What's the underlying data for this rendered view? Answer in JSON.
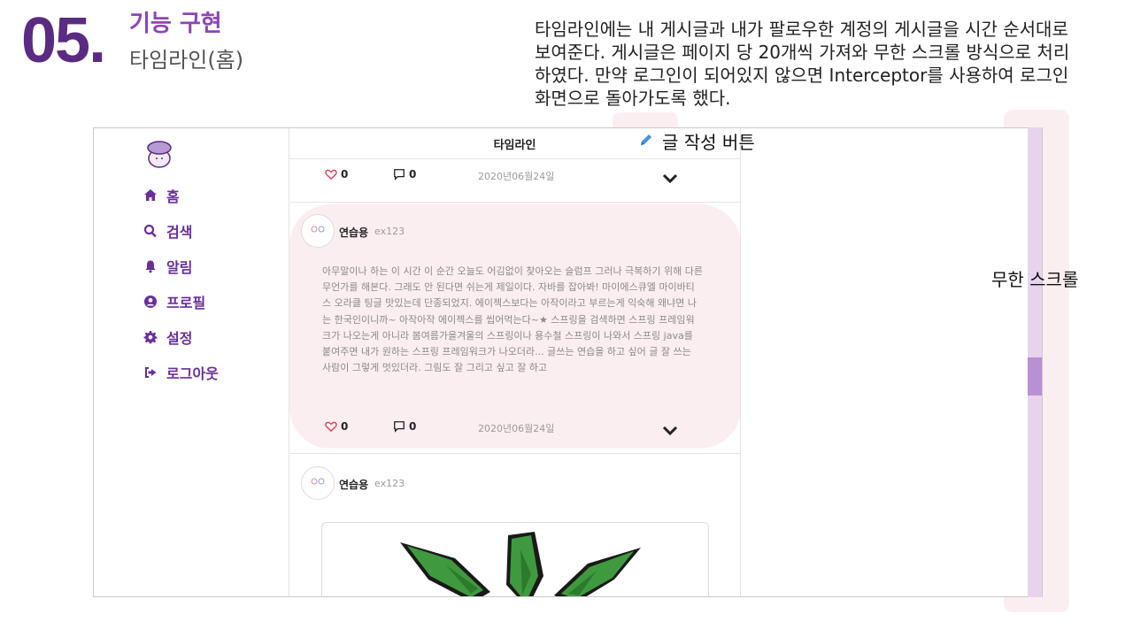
{
  "slide": {
    "number": "05",
    "dot": ".",
    "title": "기능 구현",
    "subtitle": "타임라인(홈)",
    "description": "타임라인에는 내 게시글과 내가 팔로우한 계정의 게시글을 시간 순서대로 보여준다. 게시글은 페이지 당 20개씩 가져와 무한 스크롤 방식으로 처리하였다. 만약 로그인이 되어있지 않으면 Interceptor를 사용하여 로그인 화면으로 돌아가도록 했다."
  },
  "sidebar": {
    "items": [
      {
        "label": "홈",
        "icon": "home-icon"
      },
      {
        "label": "검색",
        "icon": "search-icon"
      },
      {
        "label": "알림",
        "icon": "bell-icon"
      },
      {
        "label": "프로필",
        "icon": "user-circle-icon"
      },
      {
        "label": "설정",
        "icon": "gear-icon"
      },
      {
        "label": "로그아웃",
        "icon": "sign-out-icon"
      }
    ]
  },
  "feed": {
    "header": "타임라인",
    "posts": [
      {
        "likes": "0",
        "comments": "0",
        "date": "2020년06월24일"
      },
      {
        "username": "연습용",
        "userid": "ex123",
        "text": "아무말이나 하는 이 시간 이 순간 오늘도 어김없이 찾아오는 슬럼프 그러나 극복하기 위해 다른 무언가를 해본다. 그래도 안 된다면 쉬는게 제일이다. 자바를 잡아봐! 마이에스큐엘 마이바티스 오라클 팅글 맛있는데 단종되었지. 에이젝스보다는 아작이라고 부르는게 익숙해 왜냐면 나는 한국인이니까~ 아작아작 에이젝스를 씹어먹는다~★ 스프링을 검색하면 스프링 프레임워크가 나오는게 아니라 봄여름가을겨울의 스프링이나 용수철 스프링이 나와서 스프링 java를 붙여주면 내가 원하는 스프링 프레임워크가 나오더라... 글쓰는 연습을 하고 싶어 글 잘 쓰는 사람이 그렇게 멋있더라. 그림도 잘 그리고 싶고 잘 하고",
        "likes": "0",
        "comments": "0",
        "date": "2020년06월24일"
      },
      {
        "username": "연습용",
        "userid": "ex123"
      }
    ]
  },
  "callouts": {
    "write_button": "글 작성 버튼",
    "infinite_scroll": "무한 스크롤"
  },
  "colors": {
    "brand": "#5b2a83",
    "accent": "#8e44b8",
    "highlight": "#fbeef1",
    "like": "#e0405a"
  }
}
